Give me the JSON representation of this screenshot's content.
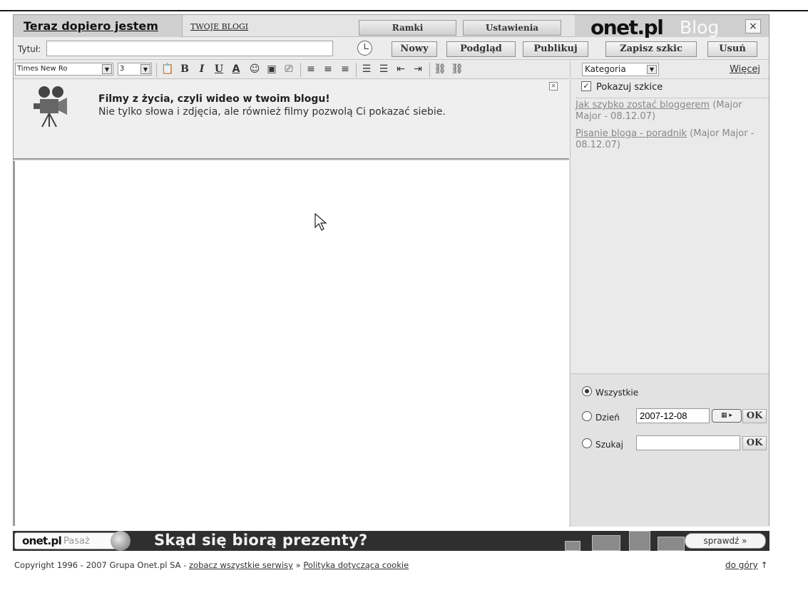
{
  "header": {
    "active_tab": "Teraz dopiero jestem",
    "your_blogs_link": "TWOJE BLOGI",
    "ramki_label": "Ramki",
    "ustawienia_label": "Ustawienia",
    "logo_onet": "onet.pl",
    "logo_blog": "Blog",
    "close_label": "×"
  },
  "title_row": {
    "title_label": "Tytuł:",
    "title_value": "",
    "buttons": {
      "new": "Nowy",
      "preview": "Podgląd",
      "publish": "Publikuj",
      "save_draft": "Zapisz szkic",
      "delete": "Usuń"
    }
  },
  "toolbar": {
    "font_family": "Times New Ro",
    "font_size": "3"
  },
  "sidebar": {
    "category_select": "Kategoria",
    "more_link": "Więcej",
    "show_drafts_label": "Pokazuj szkice",
    "show_drafts_checked": true,
    "drafts": [
      {
        "title": "Jak szybko zostać bloggerem",
        "meta": "(Major Major - 08.12.07)"
      },
      {
        "title": "Pisanie bloga - poradnik",
        "meta": "(Major Major - 08.12.07)"
      }
    ],
    "filter": {
      "all_label": "Wszystkie",
      "day_label": "Dzień",
      "day_value": "2007-12-08",
      "search_label": "Szukaj",
      "search_value": "",
      "ok_label": "OK"
    }
  },
  "promo": {
    "title": "Filmy z życia, czyli wideo w twoim blogu!",
    "text": "Nie tylko słowa i zdjęcia, ale również filmy pozwolą Ci pokazać siebie.",
    "close": "×"
  },
  "banner": {
    "logo": "onet.pl",
    "pasaz": "Pasaż",
    "headline": "Skąd się biorą prezenty?",
    "cta": "sprawdź »"
  },
  "footer": {
    "copyright": "Copyright 1996 - 2007 Grupa Onet.pl SA - ",
    "all_services_link": "zobacz wszystkie serwisy",
    "separator": " » ",
    "cookie_link": "Polityka dotycząca cookie",
    "top_link": "do góry",
    "top_arrow": "↑"
  },
  "colors": {
    "frame_bg": "#ececec",
    "banner_bg": "#2f2f2f",
    "draft_link": "#888888"
  }
}
